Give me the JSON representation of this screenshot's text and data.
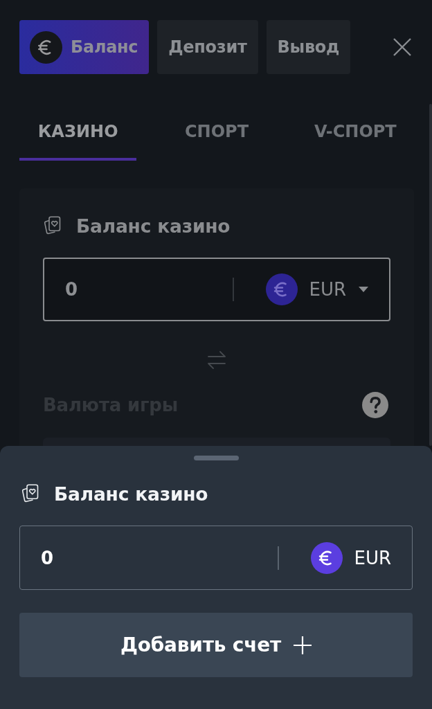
{
  "top_bar": {
    "tabs": [
      {
        "label": "Баланс",
        "selected": true,
        "coin_icon": true
      },
      {
        "label": "Депозит",
        "selected": false,
        "coin_icon": false
      },
      {
        "label": "Вывод",
        "selected": false,
        "coin_icon": false
      }
    ]
  },
  "wallet_tabs": [
    {
      "label": "КАЗИНО",
      "selected": true
    },
    {
      "label": "СПОРТ",
      "selected": false
    },
    {
      "label": "V-СПОРТ",
      "selected": false
    }
  ],
  "casino_card": {
    "title": "Баланс казино",
    "amount_field": {
      "value": "0",
      "currency": "EUR",
      "dropdown": true
    },
    "game_currency": {
      "label": "Валюта игры"
    }
  },
  "bottom_sheet": {
    "title": "Баланс казино",
    "amount_field": {
      "value": "0",
      "currency": "EUR",
      "dropdown": false
    },
    "add_button": "Добавить счет"
  }
}
